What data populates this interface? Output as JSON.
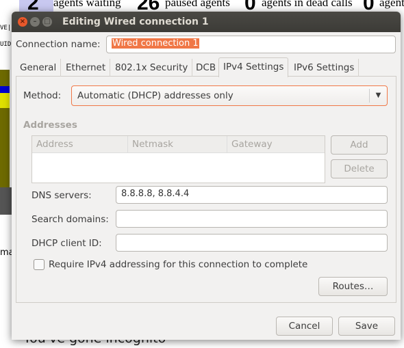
{
  "background": {
    "stats": [
      {
        "value": "2",
        "label": "agents waiting"
      },
      {
        "value": "26",
        "label": "paused agents"
      },
      {
        "value": "0",
        "label": "agents in dead calls"
      },
      {
        "value": "0",
        "label": "agents"
      }
    ],
    "strip_labels": [
      "VE|",
      "UID"
    ],
    "incognito_text": "You've gone incognito",
    "partial_text": "ma"
  },
  "dialog": {
    "title": "Editing Wired connection 1",
    "connection_name_label": "Connection name:",
    "connection_name": "Wired connection 1",
    "tabs": [
      "General",
      "Ethernet",
      "802.1x Security",
      "DCB",
      "IPv4 Settings",
      "IPv6 Settings"
    ],
    "active_tab": "IPv4 Settings",
    "method_label": "Method:",
    "method_value": "Automatic (DHCP) addresses only",
    "addresses_label": "Addresses",
    "columns": [
      "Address",
      "Netmask",
      "Gateway"
    ],
    "add_label": "Add",
    "delete_label": "Delete",
    "dns_label": "DNS servers:",
    "dns_value": "8.8.8.8, 8.8.4.4",
    "search_label": "Search domains:",
    "search_value": "",
    "dhcp_label": "DHCP client ID:",
    "dhcp_value": "",
    "require_label": "Require IPv4 addressing for this connection to complete",
    "require_checked": false,
    "routes_label": "Routes…",
    "cancel_label": "Cancel",
    "save_label": "Save"
  },
  "colors": {
    "accent": "#f07746",
    "titlebar": "#3c3b37",
    "close": "#e8582b"
  }
}
